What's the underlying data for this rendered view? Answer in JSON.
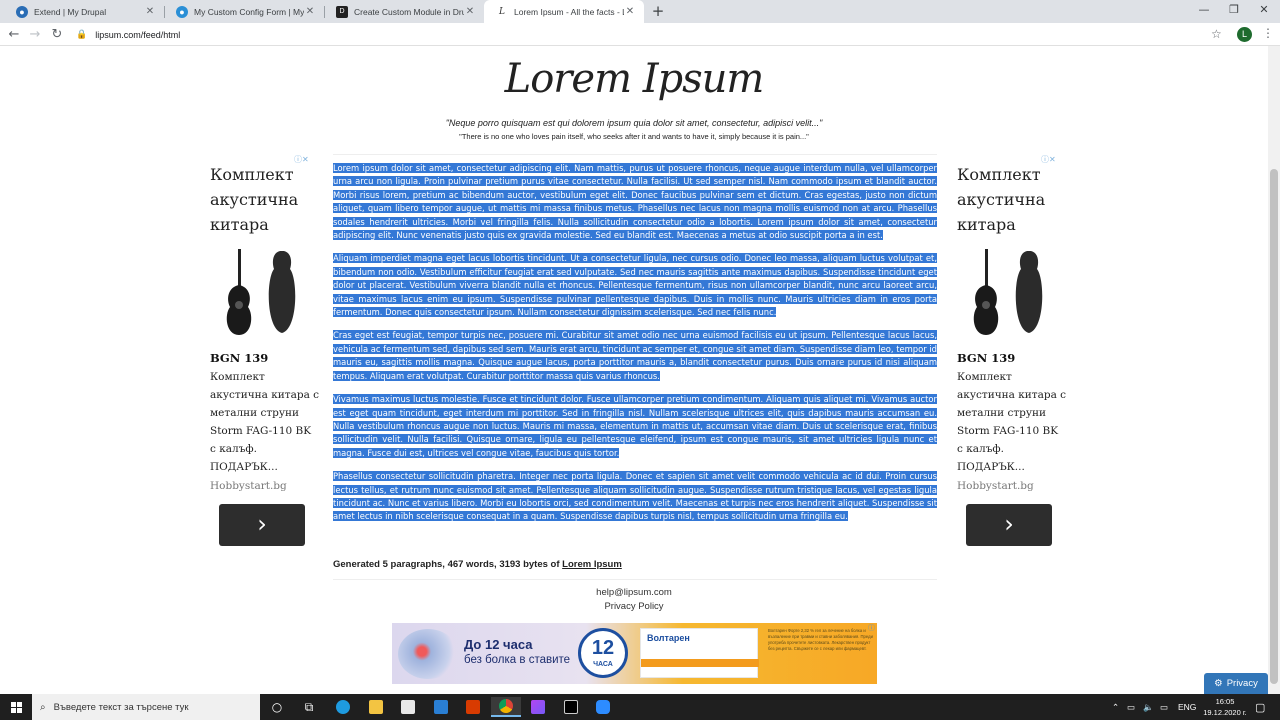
{
  "browser": {
    "tabs": [
      {
        "title": "Extend | My Drupal",
        "icon": "drupal-icon",
        "close": "✕"
      },
      {
        "title": "My Custom Config Form | My Dr",
        "icon": "drupal-icon",
        "close": "✕"
      },
      {
        "title": "Create Custom Module in Drupa",
        "icon": "d-logo-icon",
        "close": "✕"
      },
      {
        "title": "Lorem Ipsum - All the facts - Lip",
        "icon": "lipsum-icon",
        "close": "✕",
        "active": true
      }
    ],
    "new_tab": "+",
    "url": "lipsum.com/feed/html",
    "profile_initial": "L"
  },
  "page": {
    "title": "Lorem Ipsum",
    "quote_latin": "\"Neque porro quisquam est qui dolorem ipsum quia dolor sit amet, consectetur, adipisci velit...\"",
    "quote_english": "\"There is no one who loves pain itself, who seeks after it and wants to have it, simply because it is pain...\"",
    "paragraphs": [
      "Lorem ipsum dolor sit amet, consectetur adipiscing elit. Nam mattis, purus ut posuere rhoncus, neque augue interdum nulla, vel ullamcorper urna arcu non ligula. Proin pulvinar pretium purus vitae consectetur. Nulla facilisi. Ut sed semper nisl. Nam commodo ipsum et blandit auctor. Morbi risus lorem, pretium ac bibendum auctor, vestibulum eget elit. Donec faucibus pulvinar sem et dictum. Cras egestas, justo non dictum aliquet, quam libero tempor augue, ut mattis mi massa finibus metus. Phasellus nec lacus non magna mollis euismod non at arcu. Phasellus sodales hendrerit ultricies. Morbi vel fringilla felis. Nulla sollicitudin consectetur odio a lobortis. Lorem ipsum dolor sit amet, consectetur adipiscing elit. Nunc venenatis justo quis ex gravida molestie. Sed eu blandit est. Maecenas a metus at odio suscipit porta a in est.",
      "Aliquam imperdiet magna eget lacus lobortis tincidunt. Ut a consectetur ligula, nec cursus odio. Donec leo massa, aliquam luctus volutpat et, bibendum non odio. Vestibulum efficitur feugiat erat sed vulputate. Sed nec mauris sagittis ante maximus dapibus. Suspendisse tincidunt eget dolor ut placerat. Vestibulum viverra blandit nulla et rhoncus. Pellentesque fermentum, risus non ullamcorper blandit, nunc arcu laoreet arcu, vitae maximus lacus enim eu ipsum. Suspendisse pulvinar pellentesque dapibus. Duis in mollis nunc. Mauris ultricies diam in eros porta fermentum. Donec quis consectetur ipsum. Nullam consectetur dignissim scelerisque. Sed nec felis nunc.",
      "Cras eget est feugiat, tempor turpis nec, posuere mi. Curabitur sit amet odio nec urna euismod facilisis eu ut ipsum. Pellentesque lacus lacus, vehicula ac fermentum sed, dapibus sed sem. Mauris erat arcu, tincidunt ac semper et, congue sit amet diam. Suspendisse diam leo, tempor id mauris eu, sagittis mollis magna. Quisque augue lacus, porta porttitor mauris a, blandit consectetur purus. Duis ornare purus id nisi aliquam tempus. Aliquam erat volutpat. Curabitur porttitor massa quis varius rhoncus.",
      "Vivamus maximus luctus molestie. Fusce et tincidunt dolor. Fusce ullamcorper pretium condimentum. Aliquam quis aliquet mi. Vivamus auctor est eget quam tincidunt, eget interdum mi porttitor. Sed in fringilla nisl. Nullam scelerisque ultrices elit, quis dapibus mauris accumsan eu. Nulla vestibulum rhoncus augue non luctus. Mauris mi massa, elementum in mattis ut, accumsan vitae diam. Duis ut scelerisque erat, finibus sollicitudin velit. Nulla facilisi. Quisque ornare, ligula eu pellentesque eleifend, ipsum est congue mauris, sit amet ultricies ligula nunc et magna. Fusce dui est, ultrices vel congue vitae, faucibus quis tortor.",
      "Phasellus consectetur sollicitudin pharetra. Integer nec porta ligula. Donec et sapien sit amet velit commodo vehicula ac id dui. Proin cursus lectus tellus, et rutrum nunc euismod sit amet. Pellentesque aliquam sollicitudin augue. Suspendisse rutrum tristique lacus, vel egestas ligula tincidunt ac. Nunc et varius libero. Morbi eu lobortis orci, sed condimentum velit. Maecenas et turpis nec eros hendrerit aliquet. Suspendisse sit amet lectus in nibh scelerisque consequat in a quam. Suspendisse dapibus turpis nisl, tempus sollicitudin urna fringilla eu."
    ],
    "generated_text": "Generated 5 paragraphs, 467 words, 3193 bytes of ",
    "generated_link": "Lorem Ipsum",
    "footer_email": "help@lipsum.com",
    "footer_privacy": "Privacy Policy",
    "privacy_button": "Privacy"
  },
  "ads": {
    "left": {
      "title": "Комплект акустична китара",
      "brand": "BGN 139",
      "description": "Комплект акустична китара с метални струни Storm FAG-110 BK с калъф. ПОДАРЪК...",
      "site": "Hobbystart.bg",
      "button": "›"
    },
    "right": {
      "title": "Комплект акустична китара",
      "brand": "BGN 139",
      "description": "Комплект акустична китара с метални струни Storm FAG-110 BK с калъф. ПОДАРЪК...",
      "site": "Hobbystart.bg",
      "button": "›"
    },
    "banner": {
      "headline": "До 12 часа",
      "subline": "без болка в ставите",
      "badge_number": "12",
      "badge_unit": "ЧАСА",
      "product": "Волтарен",
      "fine_print": "Волтарен Форте 2,32 % гел за лечение на болка и възпаление при травми и ставни заболявания. Преди употреба прочетете листовката. Лекарствен продукт без рецепта. Свържете се с лекар или фармацевт."
    }
  },
  "taskbar": {
    "search_placeholder": "Въведете текст за търсене тук",
    "language": "ENG",
    "time": "16:05",
    "date": "19.12.2020 г."
  },
  "colors": {
    "selection": "#3478d6",
    "taskbar": "#1f1f1f",
    "privacy_button": "#3276b8"
  }
}
